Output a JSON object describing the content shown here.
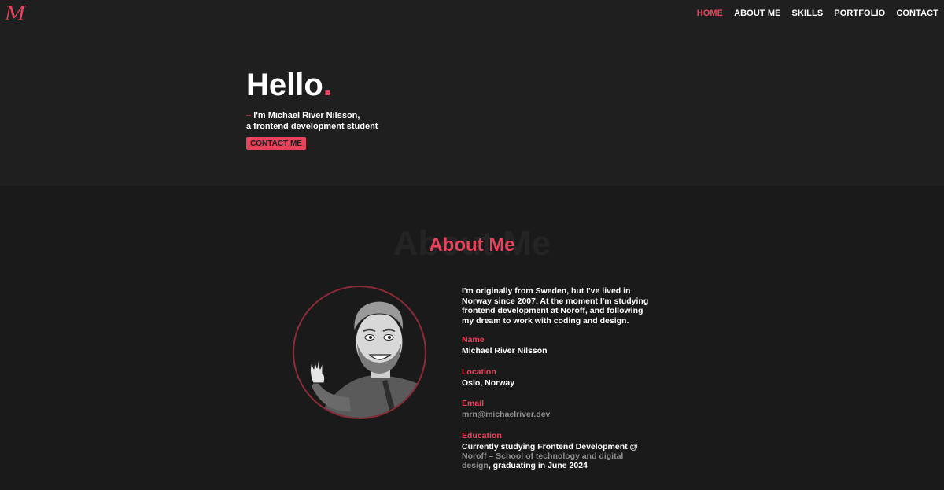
{
  "nav": {
    "logo": "M",
    "items": [
      {
        "label": "HOME",
        "active": true
      },
      {
        "label": "ABOUT ME",
        "active": false
      },
      {
        "label": "SKILLS",
        "active": false
      },
      {
        "label": "PORTFOLIO",
        "active": false
      },
      {
        "label": "CONTACT",
        "active": false
      }
    ]
  },
  "hero": {
    "title": "Hello",
    "title_dot": ".",
    "dash": "–",
    "line1": "I'm Michael River Nilsson,",
    "line2": "a frontend development student",
    "button": "CONTACT ME"
  },
  "about": {
    "ghost_title": "About Me",
    "title": "About Me",
    "bio": "I'm originally from Sweden, but I've lived in Norway since 2007. At the moment I'm studying frontend development at Noroff, and following my dream to work with coding and design.",
    "name_label": "Name",
    "name_value": "Michael River Nilsson",
    "location_label": "Location",
    "location_value": "Oslo, Norway",
    "email_label": "Email",
    "email_value": "mrn@michaelriver.dev",
    "education_label": "Education",
    "education_prefix": "Currently studying Frontend Development @ ",
    "education_school": "Noroff – School of technology and digital design",
    "education_suffix": ", graduating in June 2024"
  },
  "colors": {
    "accent": "#e8425c",
    "background": "#1e1e1f",
    "muted_link": "#8e8e8e"
  }
}
